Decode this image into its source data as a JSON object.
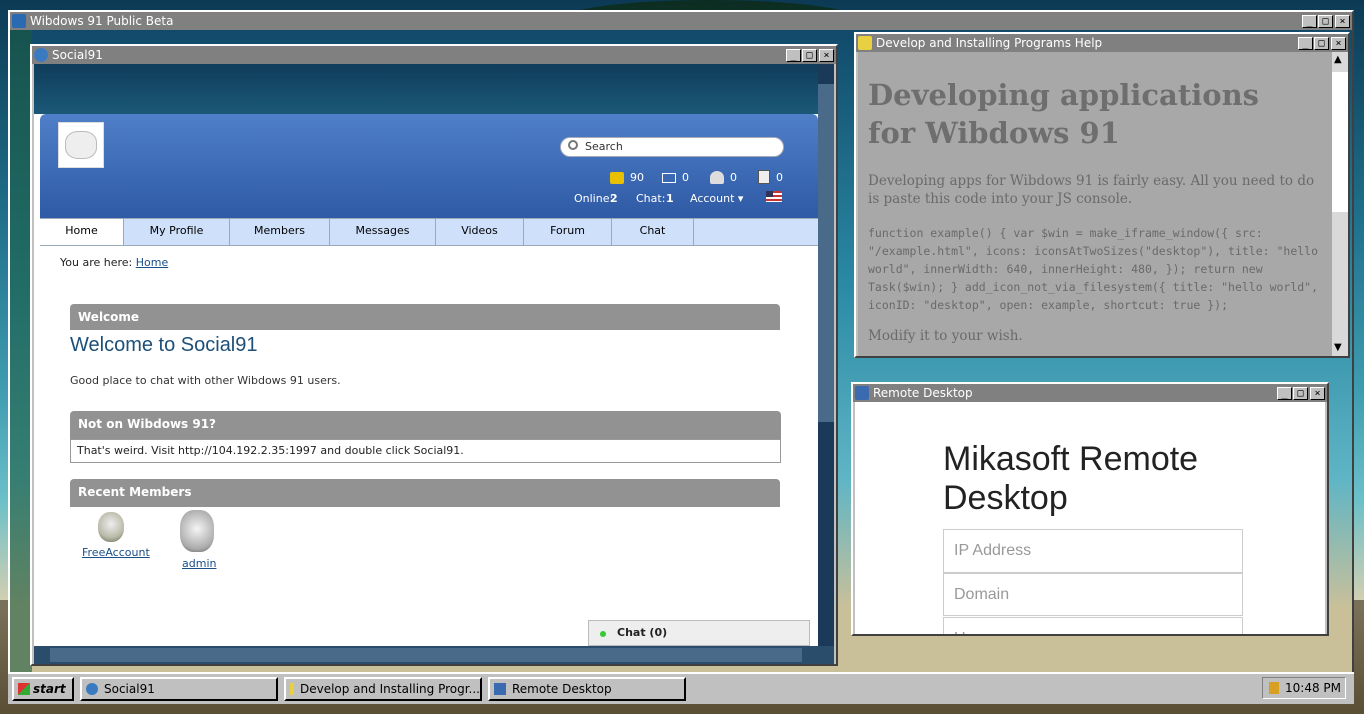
{
  "main_window": {
    "title": "Wibdows 91 Public Beta"
  },
  "social_window": {
    "title": "Social91"
  },
  "social": {
    "search_placeholder": "Search",
    "stats": {
      "credits": "90",
      "mail": "0",
      "friends": "0",
      "notes": "0"
    },
    "online_label": "Online:",
    "online_count": "2",
    "chat_label": "Chat:",
    "chat_count": "1",
    "account_label": "Account ▾",
    "nav": [
      "Home",
      "My Profile",
      "Members",
      "Messages",
      "Videos",
      "Forum",
      "Chat"
    ],
    "breadcrumb_prefix": "You are here:",
    "breadcrumb_link": "Home",
    "welcome_header": "Welcome",
    "welcome_title": "Welcome to Social91",
    "welcome_text": "Good place to chat with other Wibdows 91 users.",
    "notice_header": "Not on Wibdows 91?",
    "notice_text": "That's weird. Visit http://104.192.2.35:1997 and double click Social91.",
    "members_header": "Recent Members",
    "members": [
      "FreeAccount",
      "admin"
    ],
    "chat_bar": "Chat (0)"
  },
  "help_window": {
    "title": "Develop and Installing Programs Help",
    "heading": "Developing applications for Wibdows 91",
    "intro": "Developing apps for Wibdows 91 is fairly easy. All you need to do is paste this code into your JS console.",
    "code": "function example() { var $win = make_iframe_window({ src: \"/example.html\", icons: iconsAtTwoSizes(\"desktop\"), title: \"hello world\", innerWidth: 640, innerHeight: 480, }); return new Task($win); } add_icon_not_via_filesystem({ title: \"hello world\", iconID: \"desktop\", open: example, shortcut: true });",
    "outro": "Modify it to your wish."
  },
  "remote_window": {
    "title": "Remote Desktop",
    "heading": "Mikasoft Remote Desktop",
    "ip_placeholder": "IP Address",
    "domain_placeholder": "Domain",
    "user_placeholder": "U"
  },
  "taskbar": {
    "start": "start",
    "tasks": [
      "Social91",
      "Develop and Installing Progr...",
      "Remote Desktop"
    ],
    "clock": "10:48 PM"
  },
  "colors": {
    "accent_blue": "#2f5aa5",
    "nav_bg": "#cfe0fb",
    "section_gray": "#929292",
    "titlebar": "#808080"
  }
}
